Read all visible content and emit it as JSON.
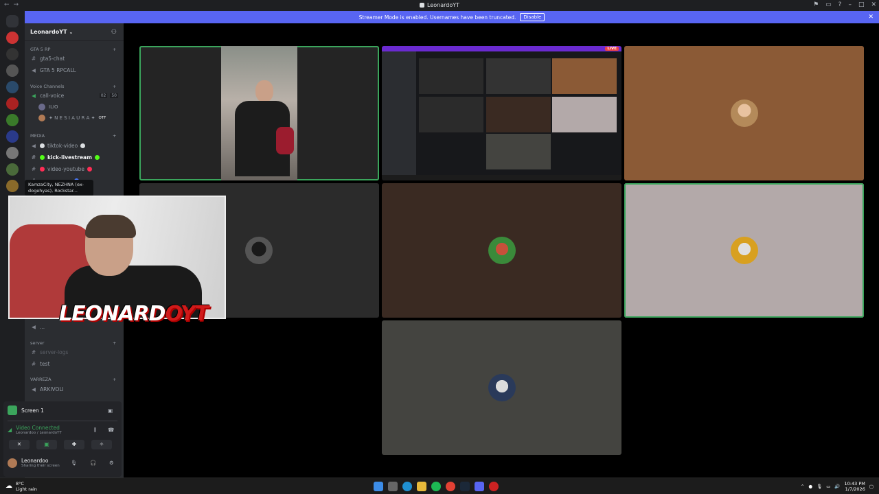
{
  "window": {
    "title": "LeonardoYT",
    "nav_back": "←",
    "nav_forward": "→"
  },
  "banner": {
    "text": "Streamer Mode is enabled. Usernames have been truncated.",
    "disable_label": "Disable",
    "close_label": "✕"
  },
  "server": {
    "name": "LeonardoYT"
  },
  "channels": {
    "cat_gta": "GTA 5 RP",
    "gta_chat": "gta5-chat",
    "gta_rpcall": "GTA 5 RPCALL",
    "cat_voice": "Voice Channels",
    "call_voice": "call-voice",
    "call_voice_count_a": "02",
    "call_voice_count_b": "50",
    "voice_user_1": "ILIO",
    "voice_user_2": "✦ N E S I A U R A ✦",
    "voice_user_2_badge": "OTF",
    "cat_media": "MEDIA",
    "tiktok": "tiktok-video",
    "kick": "kick-livestream",
    "youtube": "video-youtube",
    "hidden_channel": "----------- -----",
    "dots_channel": "...",
    "cat_server": "server",
    "server_logs": "server-logs",
    "test": "test",
    "cat_varreza": "VARREZA",
    "arkivoli": "ARKIVOLI"
  },
  "tooltip": {
    "text": "KamzaCity, NEZHNA (ex-dogehyas), Rockstar..."
  },
  "voice_panel": {
    "screen_label": "Screen 1",
    "status": "Video Connected",
    "path": "Leonardoo / LeonardoYT",
    "username": "Leonardoo",
    "user_status": "Sharing their screen"
  },
  "overlay": {
    "watermark_a": "LEONARD",
    "watermark_b": "OYT"
  },
  "stream": {
    "live_badge": "LIVE"
  },
  "taskbar": {
    "temp": "8°C",
    "weather": "Light rain",
    "time": "10:43 PM",
    "date": "1/7/2026"
  },
  "colors": {
    "accent": "#5865f2",
    "speaking": "#3ba55c",
    "tile_brown": "#8b5a36",
    "tile_dark": "#2b2b2b",
    "tile_dkbrown": "#3a2a22",
    "tile_gray": "#b3a9a9",
    "tile_olive": "#444440"
  }
}
